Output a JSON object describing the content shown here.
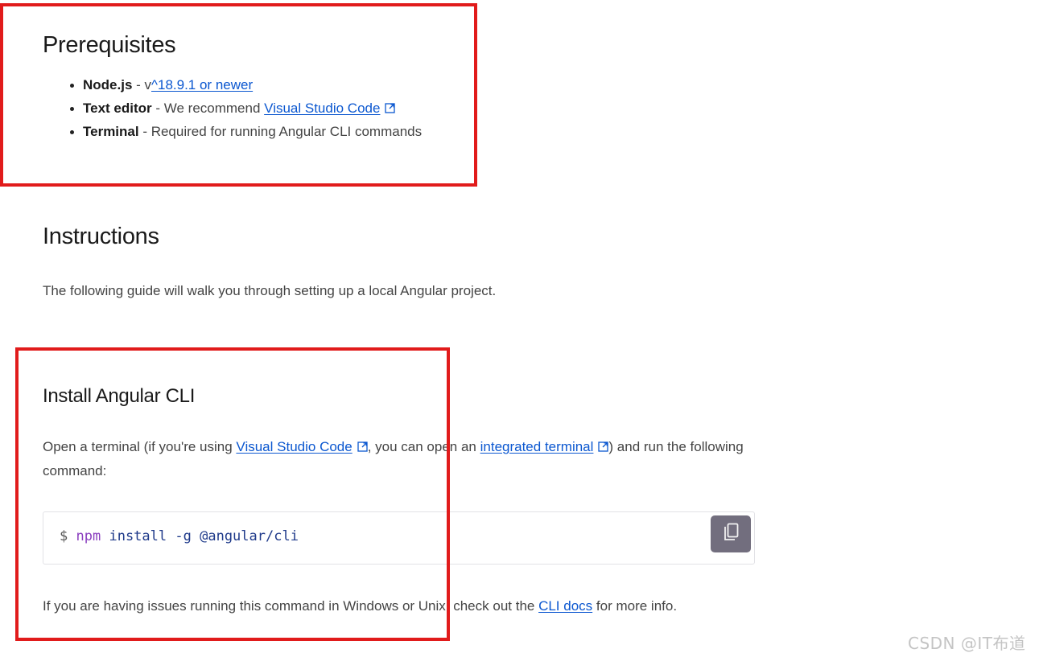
{
  "prerequisites": {
    "title": "Prerequisites",
    "items": [
      {
        "name": "Node.js",
        "sep": " - v",
        "link": "^18.9.1 or newer"
      },
      {
        "name": "Text editor",
        "sep": " - We recommend ",
        "link": "Visual Studio Code"
      },
      {
        "name": "Terminal",
        "text": " - Required for running Angular CLI commands"
      }
    ]
  },
  "instructions": {
    "title": "Instructions",
    "intro": "The following guide will walk you through setting up a local Angular project."
  },
  "install": {
    "title": "Install Angular CLI",
    "para_1": "Open a terminal (if you're using ",
    "link_1": "Visual Studio Code",
    "para_2": ", you can open an ",
    "link_2": "integrated terminal",
    "para_3": ") and run the following command:",
    "code": {
      "prompt": "$",
      "npm": "npm",
      "cmd": "install",
      "flag": "-g",
      "pkg": "@angular/cli"
    },
    "footer_1": "If you are having issues running this command in Windows or Unix, check out the ",
    "footer_link": "CLI docs",
    "footer_2": " for more info."
  },
  "icons": {
    "external": "external-link-icon",
    "copy": "copy-icon"
  },
  "colors": {
    "link": "#0b57d0",
    "highlight_box": "#e11b1b",
    "copy_button": "#726e7e"
  },
  "watermark": "CSDN @IT布道"
}
